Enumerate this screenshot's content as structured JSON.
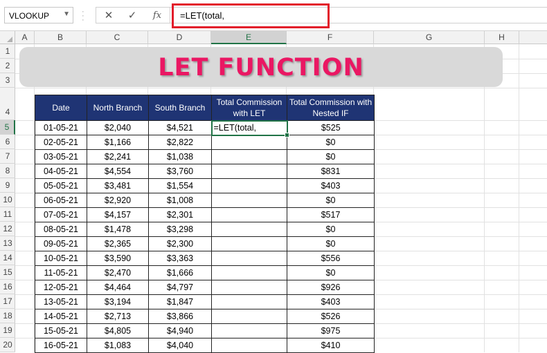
{
  "formula_bar": {
    "name_box": "VLOOKUP",
    "cancel_icon": "✕",
    "enter_icon": "✓",
    "fx_icon": "fx",
    "formula": "=LET(total,"
  },
  "columns": [
    "A",
    "B",
    "C",
    "D",
    "E",
    "F",
    "G",
    "H"
  ],
  "rows": [
    "1",
    "2",
    "3",
    "4",
    "5",
    "6",
    "7",
    "8",
    "9",
    "10",
    "11",
    "12",
    "13",
    "14",
    "15",
    "16",
    "17",
    "18",
    "19",
    "20"
  ],
  "banner": {
    "title": "LET FUNCTION"
  },
  "table": {
    "headers": [
      "Date",
      "North Branch",
      "South Branch",
      "Total Commission with LET",
      "Total Commission with Nested IF"
    ],
    "rows": [
      {
        "date": "01-05-21",
        "north": "$2,040",
        "south": "$4,521",
        "let": "=LET(total,",
        "nested": "$525"
      },
      {
        "date": "02-05-21",
        "north": "$1,166",
        "south": "$2,822",
        "let": "",
        "nested": "$0"
      },
      {
        "date": "03-05-21",
        "north": "$2,241",
        "south": "$1,038",
        "let": "",
        "nested": "$0"
      },
      {
        "date": "04-05-21",
        "north": "$4,554",
        "south": "$3,760",
        "let": "",
        "nested": "$831"
      },
      {
        "date": "05-05-21",
        "north": "$3,481",
        "south": "$1,554",
        "let": "",
        "nested": "$403"
      },
      {
        "date": "06-05-21",
        "north": "$2,920",
        "south": "$1,008",
        "let": "",
        "nested": "$0"
      },
      {
        "date": "07-05-21",
        "north": "$4,157",
        "south": "$2,301",
        "let": "",
        "nested": "$517"
      },
      {
        "date": "08-05-21",
        "north": "$1,478",
        "south": "$3,298",
        "let": "",
        "nested": "$0"
      },
      {
        "date": "09-05-21",
        "north": "$2,365",
        "south": "$2,300",
        "let": "",
        "nested": "$0"
      },
      {
        "date": "10-05-21",
        "north": "$3,590",
        "south": "$3,363",
        "let": "",
        "nested": "$556"
      },
      {
        "date": "11-05-21",
        "north": "$2,470",
        "south": "$1,666",
        "let": "",
        "nested": "$0"
      },
      {
        "date": "12-05-21",
        "north": "$4,464",
        "south": "$4,797",
        "let": "",
        "nested": "$926"
      },
      {
        "date": "13-05-21",
        "north": "$3,194",
        "south": "$1,847",
        "let": "",
        "nested": "$403"
      },
      {
        "date": "14-05-21",
        "north": "$2,713",
        "south": "$3,866",
        "let": "",
        "nested": "$526"
      },
      {
        "date": "15-05-21",
        "north": "$4,805",
        "south": "$4,940",
        "let": "",
        "nested": "$975"
      },
      {
        "date": "16-05-21",
        "north": "$1,083",
        "south": "$4,040",
        "let": "",
        "nested": "$410"
      }
    ]
  },
  "colors": {
    "header_fill": "#1f3474",
    "title_color": "#ea1763",
    "selection_green": "#217346",
    "highlight_red": "#e21b2a"
  }
}
